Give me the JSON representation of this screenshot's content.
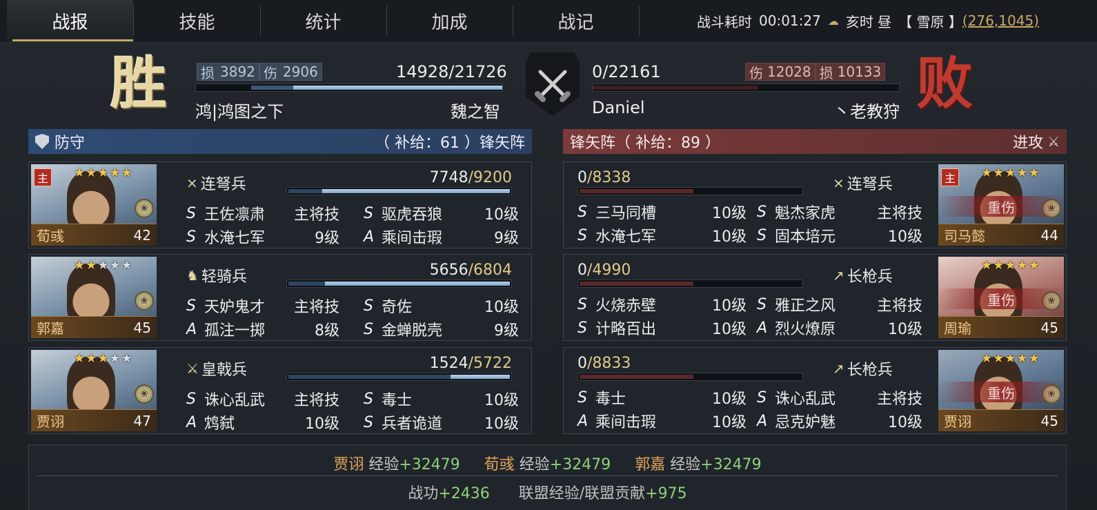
{
  "tabs": [
    "战报",
    "技能",
    "统计",
    "加成",
    "战记"
  ],
  "battle_info": {
    "label": "战斗耗时",
    "duration": "00:01:27",
    "time_of_day": "亥时 昼",
    "terrain": "【 雪原 】",
    "coords": "(276,1045)"
  },
  "left": {
    "result": "胜",
    "loss_label": "损",
    "loss_value": "3892",
    "damage_label": "伤",
    "damage_value": "2906",
    "troops_current": "14928",
    "troops_max": "/21726",
    "hp_fraction": 0.687,
    "alliance": "鸿|鸿图之下",
    "player": "魏之智",
    "stance": "防守",
    "supply_text": "（ 补给：61 ）锋矢阵",
    "generals": [
      {
        "name": "荀彧",
        "level": "42",
        "stars": 5,
        "is_main": true,
        "unit": "连弩兵",
        "troops": "7748",
        "troops_max": "/9200",
        "troops_fraction": 0.842,
        "skills": [
          {
            "grade": "S",
            "name": "王佐凛肃",
            "level": "主将技"
          },
          {
            "grade": "S",
            "name": "驱虎吞狼",
            "level": "10级"
          },
          {
            "grade": "S",
            "name": "水淹七军",
            "level": "9级"
          },
          {
            "grade": "A",
            "name": "乘间击瑕",
            "level": "9级"
          }
        ]
      },
      {
        "name": "郭嘉",
        "level": "45",
        "stars": 5,
        "lit_stars": 2,
        "is_main": false,
        "unit": "轻骑兵",
        "troops": "5656",
        "troops_max": "/6804",
        "troops_fraction": 0.831,
        "skills": [
          {
            "grade": "S",
            "name": "天妒鬼才",
            "level": "主将技"
          },
          {
            "grade": "S",
            "name": "奇佐",
            "level": "10级"
          },
          {
            "grade": "A",
            "name": "孤注一掷",
            "level": "8级"
          },
          {
            "grade": "S",
            "name": "金蝉脱壳",
            "level": "9级"
          }
        ]
      },
      {
        "name": "贾诩",
        "level": "47",
        "stars": 5,
        "lit_stars": 3,
        "is_main": false,
        "unit": "皇戟兵",
        "troops": "1524",
        "troops_max": "/5722",
        "troops_fraction": 0.266,
        "skills": [
          {
            "grade": "S",
            "name": "诛心乱武",
            "level": "主将技"
          },
          {
            "grade": "S",
            "name": "毒士",
            "level": "10级"
          },
          {
            "grade": "A",
            "name": "鸩弑",
            "level": "10级"
          },
          {
            "grade": "S",
            "name": "兵者诡道",
            "level": "10级"
          }
        ]
      }
    ]
  },
  "right": {
    "result": "败",
    "loss_label": "损",
    "loss_value": "10133",
    "damage_label": "伤",
    "damage_value": "12028",
    "troops_current": "0",
    "troops_max": "/22161",
    "hp_fraction": 0.0,
    "alliance": "Daniel",
    "player": "丶老教狩",
    "stance": "进攻",
    "supply_text": "锋矢阵（ 补给：89 ）",
    "generals": [
      {
        "name": "司马懿",
        "level": "44",
        "stars": 5,
        "is_main": true,
        "status": "重伤",
        "unit": "连弩兵",
        "troops": "0",
        "troops_max": "/8338",
        "troops_fraction": 0.0,
        "skills": [
          {
            "grade": "S",
            "name": "三马同槽",
            "level": "10级"
          },
          {
            "grade": "S",
            "name": "魁杰家虎",
            "level": "主将技"
          },
          {
            "grade": "S",
            "name": "水淹七军",
            "level": "10级"
          },
          {
            "grade": "S",
            "name": "固本培元",
            "level": "10级"
          }
        ]
      },
      {
        "name": "周瑜",
        "level": "45",
        "stars": 5,
        "is_main": false,
        "status": "重伤",
        "unit": "长枪兵",
        "troops": "0",
        "troops_max": "/4990",
        "troops_fraction": 0.0,
        "skills": [
          {
            "grade": "S",
            "name": "火烧赤壁",
            "level": "10级"
          },
          {
            "grade": "S",
            "name": "雅正之风",
            "level": "主将技"
          },
          {
            "grade": "S",
            "name": "计略百出",
            "level": "10级"
          },
          {
            "grade": "A",
            "name": "烈火燎原",
            "level": "10级"
          }
        ]
      },
      {
        "name": "贾诩",
        "level": "45",
        "stars": 5,
        "is_main": false,
        "status": "重伤",
        "unit": "长枪兵",
        "troops": "0",
        "troops_max": "/8833",
        "troops_fraction": 0.0,
        "skills": [
          {
            "grade": "S",
            "name": "毒士",
            "level": "10级"
          },
          {
            "grade": "S",
            "name": "诛心乱武",
            "level": "主将技"
          },
          {
            "grade": "A",
            "name": "乘间击瑕",
            "level": "10级"
          },
          {
            "grade": "A",
            "name": "忌克妒魅",
            "level": "10级"
          }
        ]
      }
    ]
  },
  "main_badge": "主",
  "experience": [
    {
      "name": "贾诩",
      "label": "经验",
      "value": "+32479"
    },
    {
      "name": "荀彧",
      "label": "经验",
      "value": "+32479"
    },
    {
      "name": "郭嘉",
      "label": "经验",
      "value": "+32479"
    }
  ],
  "rewards": {
    "merit_label": "战功",
    "merit_value": "+2436",
    "alliance_label": "联盟经验/联盟贡献",
    "alliance_value": "+975"
  },
  "colors": {
    "win_gold": "#e8d7a6",
    "lose_red": "#c03a30",
    "defense_blue": "#2e4b72",
    "attack_red": "#7a3a3a",
    "exp_green": "#8fd17a"
  }
}
